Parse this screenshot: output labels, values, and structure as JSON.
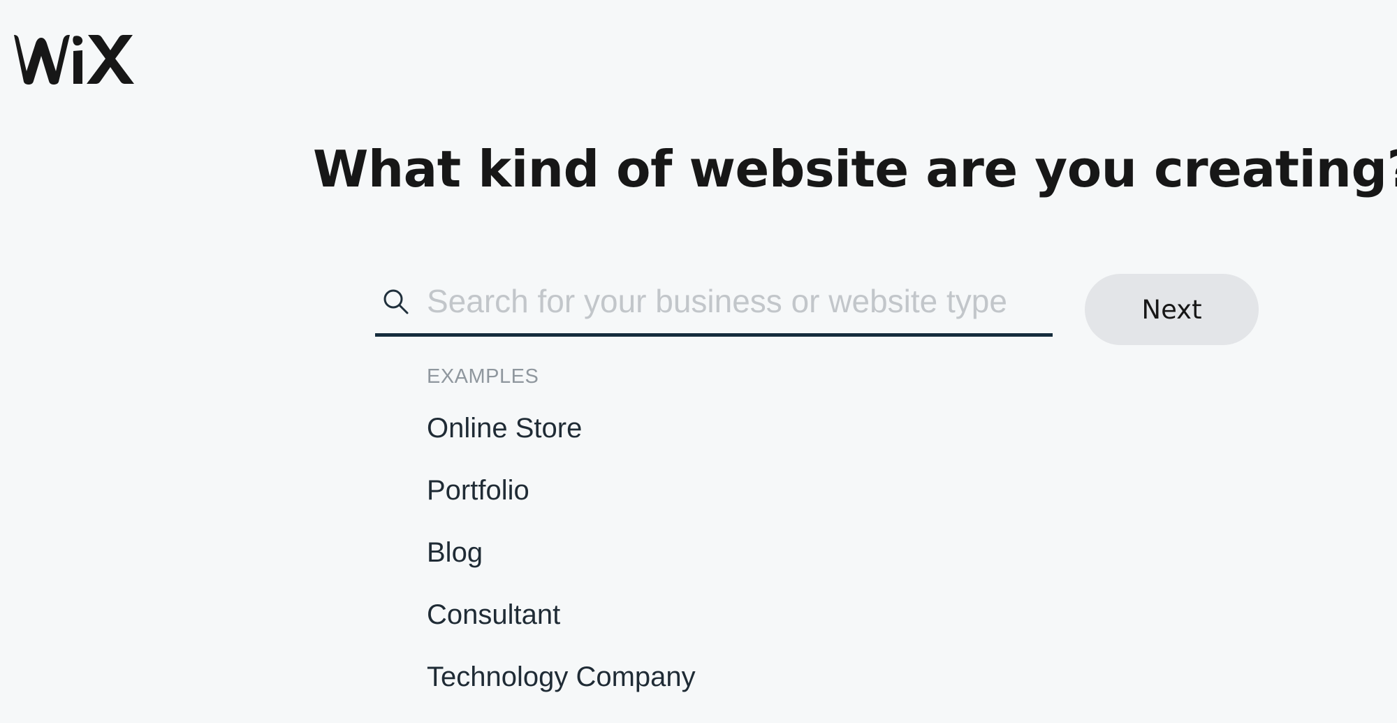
{
  "brand": {
    "logo_text": "WiX",
    "color": "#171717"
  },
  "page": {
    "title": "What kind of website are you creating?"
  },
  "search": {
    "icon": "search-icon",
    "placeholder": "Search for your business or website type",
    "value": ""
  },
  "next_button": {
    "label": "Next"
  },
  "examples": {
    "heading": "EXAMPLES",
    "items": [
      {
        "label": "Online Store"
      },
      {
        "label": "Portfolio"
      },
      {
        "label": "Blog"
      },
      {
        "label": "Consultant"
      },
      {
        "label": "Technology Company"
      }
    ]
  },
  "colors": {
    "background": "#f6f8f9",
    "underline": "#162d3d",
    "button_bg": "#e3e5e8",
    "placeholder": "#c2c6ca",
    "muted": "#8f979e"
  }
}
